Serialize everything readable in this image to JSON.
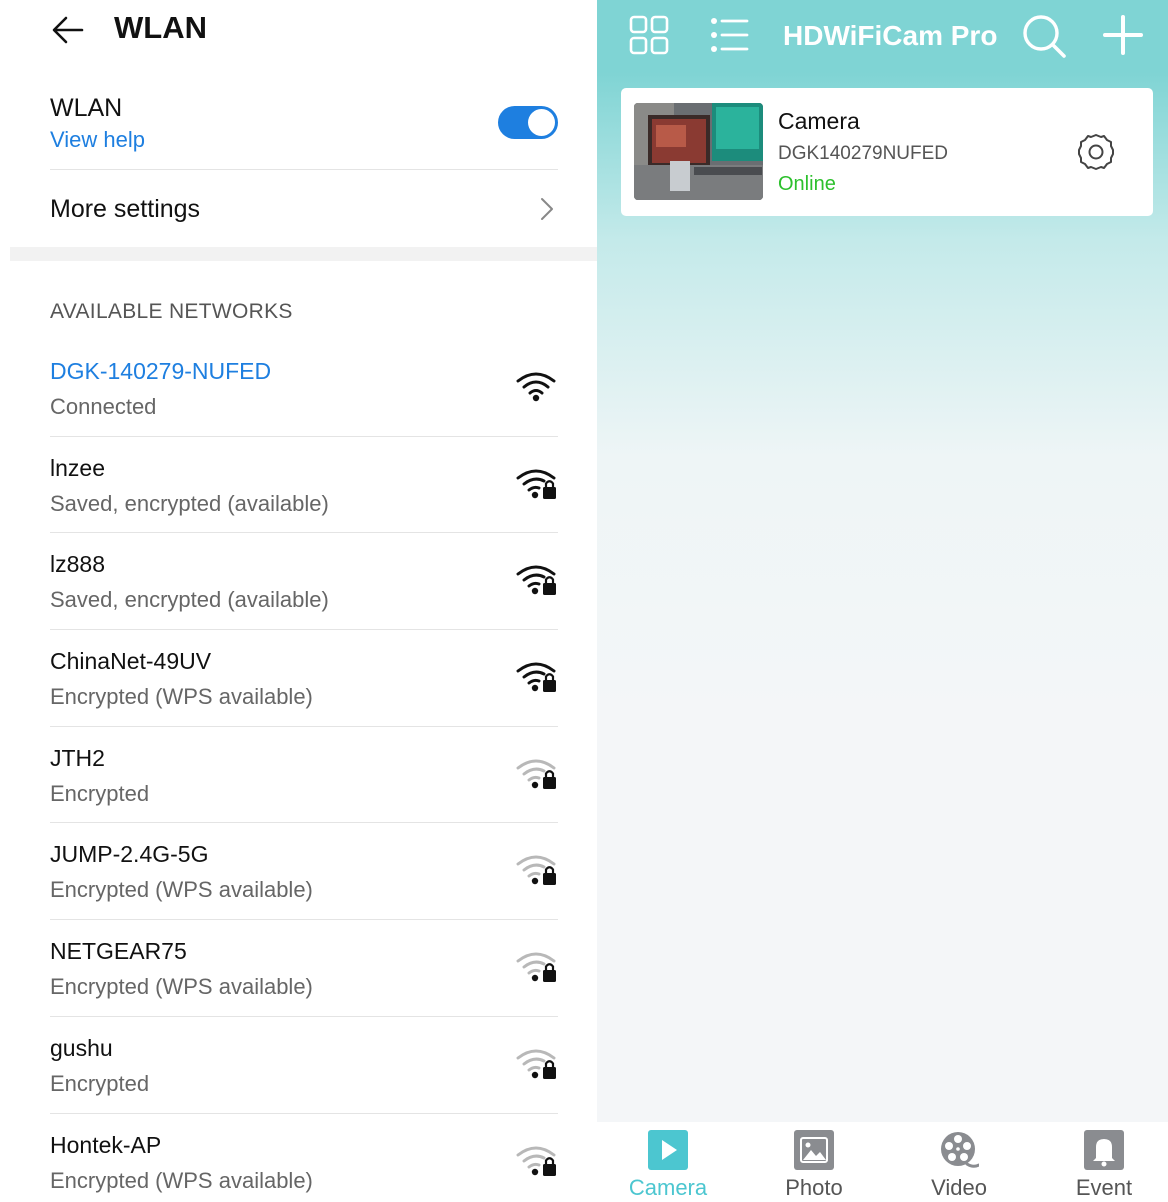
{
  "wlan": {
    "title": "WLAN",
    "toggle_label": "WLAN",
    "help_link": "View help",
    "toggle_on": true,
    "more_settings": "More settings",
    "section_header": "AVAILABLE NETWORKS",
    "networks": [
      {
        "name": "DGK-140279-NUFED",
        "status": "Connected",
        "signal": "strong",
        "locked": false
      },
      {
        "name": "lnzee",
        "status": "Saved, encrypted (available)",
        "signal": "strong",
        "locked": true
      },
      {
        "name": "lz888",
        "status": "Saved, encrypted (available)",
        "signal": "strong",
        "locked": true
      },
      {
        "name": "ChinaNet-49UV",
        "status": "Encrypted (WPS available)",
        "signal": "strong",
        "locked": true
      },
      {
        "name": "JTH2",
        "status": "Encrypted",
        "signal": "weak",
        "locked": true
      },
      {
        "name": "JUMP-2.4G-5G",
        "status": "Encrypted (WPS available)",
        "signal": "weak",
        "locked": true
      },
      {
        "name": "NETGEAR75",
        "status": "Encrypted (WPS available)",
        "signal": "weak",
        "locked": true
      },
      {
        "name": "gushu",
        "status": "Encrypted",
        "signal": "weak",
        "locked": true
      },
      {
        "name": "Hontek-AP",
        "status": "Encrypted (WPS available)",
        "signal": "weak",
        "locked": true
      }
    ]
  },
  "cam_app": {
    "title": "HDWiFiCam Pro",
    "camera": {
      "name": "Camera",
      "id": "DGK140279NUFED",
      "status": "Online"
    },
    "tabs": [
      {
        "label": "Camera",
        "icon": "play-icon",
        "active": true
      },
      {
        "label": "Photo",
        "icon": "photo-icon",
        "active": false
      },
      {
        "label": "Video",
        "icon": "film-reel-icon",
        "active": false
      },
      {
        "label": "Event",
        "icon": "bell-icon",
        "active": false
      }
    ]
  },
  "colors": {
    "accent_blue": "#1e7fe0",
    "online_green": "#2cc02c",
    "teal_header": "#7fd4d4",
    "tab_active": "#4cc6d0"
  }
}
